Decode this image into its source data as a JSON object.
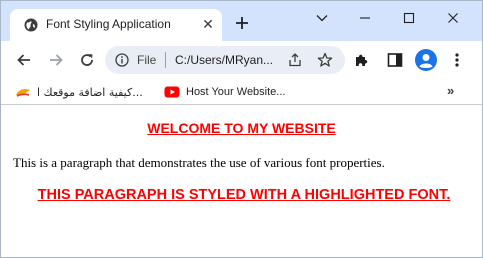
{
  "window": {
    "tab_title": "Font Styling Application",
    "tab_close": "✕",
    "new_tab": "+"
  },
  "toolbar": {
    "scheme_label": "File",
    "url": "C:/Users/MRyan..."
  },
  "bookmarks": {
    "items": [
      {
        "label": "كيفية اضافة موقعك ا...",
        "icon": "bookmark-favicon-icon"
      },
      {
        "label": "Host Your Website...",
        "icon": "youtube-icon"
      }
    ],
    "more": "»"
  },
  "page": {
    "heading": "WELCOME TO MY WEBSITE",
    "paragraph": "This is a paragraph that demonstrates the use of various font properties.",
    "highlight": "THIS PARAGRAPH IS STYLED WITH A HIGHLIGHTED FONT."
  },
  "colors": {
    "accent_red": "#ff0000",
    "tabstrip_bg": "#d3e3fd",
    "omnibox_bg": "#e9eef6",
    "profile_blue": "#1a73e8"
  }
}
